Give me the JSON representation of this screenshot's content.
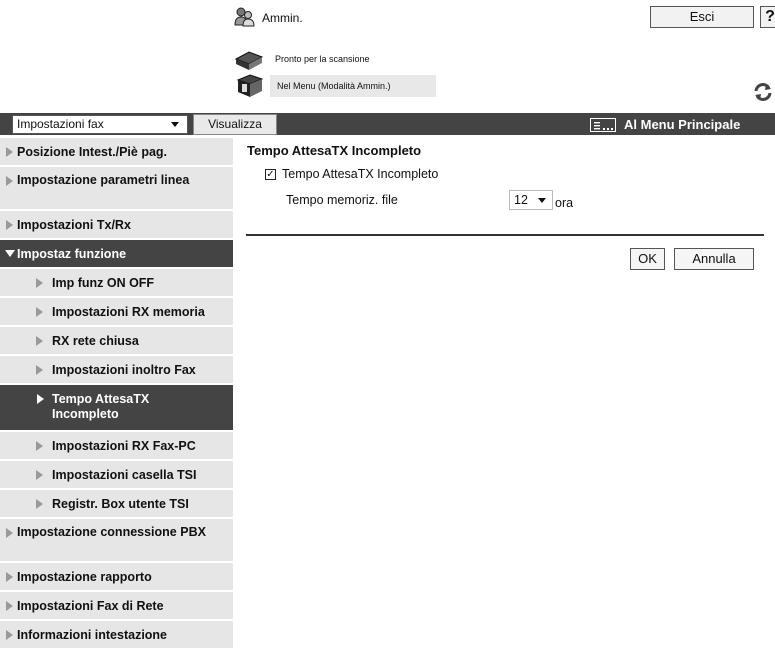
{
  "header": {
    "user_label": "Ammin.",
    "exit_label": "Esci",
    "help_label": "?",
    "status_line1": "Pronto per la scansione",
    "status_line2": "Nel Menu (Modalità Ammin.)"
  },
  "toolbar": {
    "function_select": "Impostazioni fax",
    "view_label": "Visualizza",
    "main_menu_label": "Al Menu Principale"
  },
  "sidebar": {
    "items": [
      {
        "label": "Posizione Intest./Piè pag."
      },
      {
        "label": "Impostazione parametri linea"
      },
      {
        "label": "Impostazioni Tx/Rx"
      },
      {
        "label": "Impostaz funzione"
      },
      {
        "label": "Imp funz ON OFF"
      },
      {
        "label": "Impostazioni RX memoria"
      },
      {
        "label": "RX rete chiusa"
      },
      {
        "label": "Impostazioni inoltro Fax"
      },
      {
        "label": "Tempo AttesaTX Incompleto"
      },
      {
        "label": "Impostazioni RX Fax-PC"
      },
      {
        "label": "Impostazioni casella TSI"
      },
      {
        "label": "Registr. Box utente TSI"
      },
      {
        "label": "Impostazione connessione PBX"
      },
      {
        "label": "Impostazione rapporto"
      },
      {
        "label": "Impostazioni Fax di Rete"
      },
      {
        "label": "Informazioni intestazione"
      }
    ]
  },
  "content": {
    "title": "Tempo AttesaTX Incompleto",
    "checkbox_label": "Tempo AttesaTX Incompleto",
    "checkbox_checked": true,
    "memory_time_label": "Tempo memoriz. file",
    "hours_value": "12",
    "hours_unit": "ora",
    "ok_label": "OK",
    "cancel_label": "Annulla"
  },
  "colors": {
    "dark_bar": "#444444",
    "sidebar_bg": "#e6e6e6"
  }
}
